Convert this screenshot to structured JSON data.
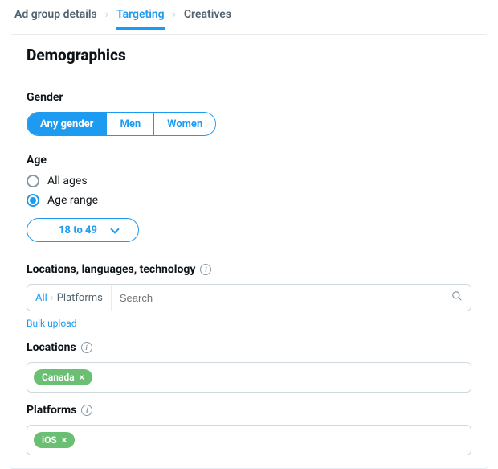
{
  "breadcrumbs": {
    "items": [
      "Ad group details",
      "Targeting",
      "Creatives"
    ],
    "active_index": 1
  },
  "page_title": "Demographics",
  "gender": {
    "label": "Gender",
    "options": [
      "Any gender",
      "Men",
      "Women"
    ],
    "selected_index": 0
  },
  "age": {
    "label": "Age",
    "mode_options": [
      "All ages",
      "Age range"
    ],
    "selected_mode_index": 1,
    "range_label": "18 to 49"
  },
  "search_section": {
    "label": "Locations, languages, technology",
    "filter_root": "All",
    "filter_current": "Platforms",
    "placeholder": "Search",
    "bulk_label": "Bulk upload"
  },
  "locations": {
    "label": "Locations",
    "chips": [
      "Canada"
    ]
  },
  "platforms": {
    "label": "Platforms",
    "chips": [
      "iOS"
    ]
  }
}
